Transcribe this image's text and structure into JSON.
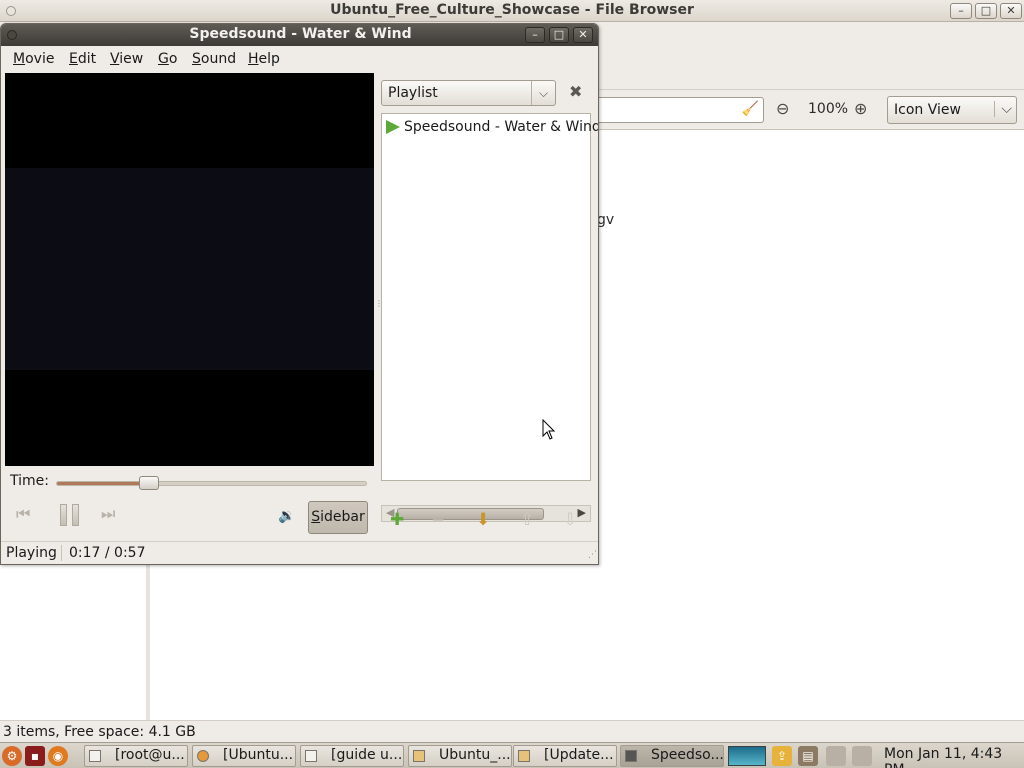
{
  "file_browser": {
    "title": "Ubuntu_Free_Culture_Showcase - File Browser",
    "window_buttons": [
      "–",
      "□",
      "✕"
    ],
    "zoom_level": "100%",
    "view_mode": "Icon View",
    "visible_file_fragment": "gv",
    "status": "3 items, Free space: 4.1 GB"
  },
  "totem": {
    "title": "Speedsound - Water & Wind",
    "window_buttons": [
      "–",
      "□",
      "✕"
    ],
    "menu": [
      {
        "label": "Movie",
        "mnemonic": "M"
      },
      {
        "label": "Edit",
        "mnemonic": "E"
      },
      {
        "label": "View",
        "mnemonic": "V"
      },
      {
        "label": "Go",
        "mnemonic": "G"
      },
      {
        "label": "Sound",
        "mnemonic": "S"
      },
      {
        "label": "Help",
        "mnemonic": "H"
      }
    ],
    "sidebar_selector": "Playlist",
    "playlist": [
      {
        "label": "Speedsound - Water & Wind",
        "playing": true
      }
    ],
    "time_label": "Time:",
    "position": 0.17,
    "sidebar_button": "Sidebar",
    "status": "Playing",
    "time_display": "0:17 / 0:57"
  },
  "panel": {
    "tasks": [
      {
        "label": "[root@u...",
        "active": false
      },
      {
        "label": "[Ubuntu...",
        "active": false
      },
      {
        "label": "[guide u...",
        "active": false
      },
      {
        "label": "Ubuntu_...",
        "active": false
      },
      {
        "label": "[Update...",
        "active": false
      },
      {
        "label": "Speedso...",
        "active": true
      }
    ],
    "clock": "Mon Jan 11,  4:43 PM"
  },
  "colors": {
    "accent": "#b07a5a",
    "playlist_play": "#5ea83a",
    "titlebar_dark": "#3d3b37"
  }
}
